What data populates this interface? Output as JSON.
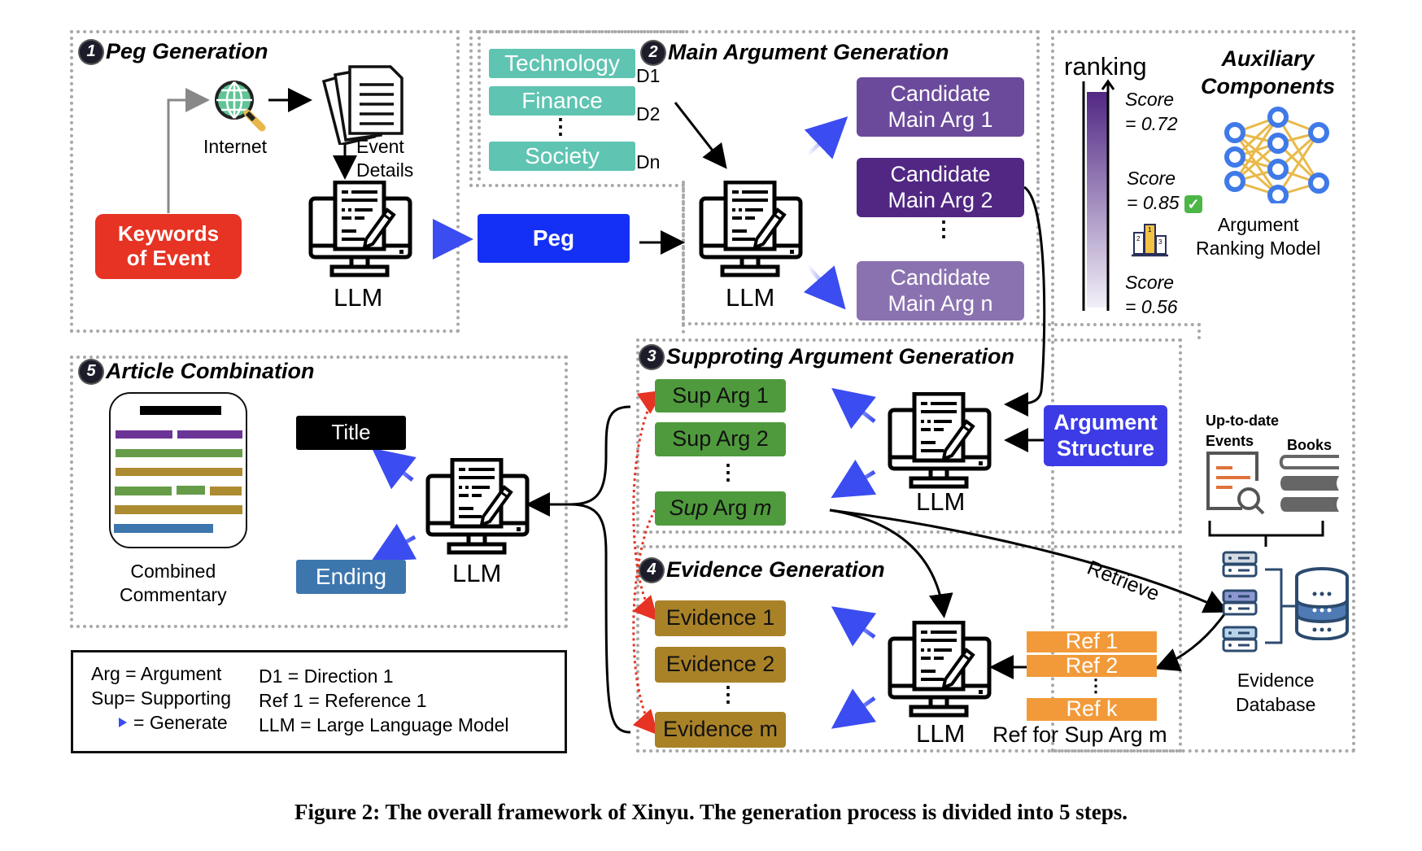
{
  "sections": {
    "s1": {
      "num": "1",
      "title": "Peg Generation"
    },
    "s2": {
      "num": "2",
      "title": "Main Argument Generation"
    },
    "s3": {
      "num": "3",
      "title": "Supproting Argument Generation"
    },
    "s4": {
      "num": "4",
      "title": "Evidence Generation"
    },
    "s5": {
      "num": "5",
      "title": "Article Combination"
    }
  },
  "peg_generation": {
    "keywords": "Keywords of Event",
    "internet_label": "Internet",
    "event_details_label": "Event Details",
    "llm_label": "LLM",
    "peg_label": "Peg"
  },
  "directions": [
    {
      "label": "Technology",
      "tag": "D1"
    },
    {
      "label": "Finance",
      "tag": "D2"
    },
    {
      "label": "Society",
      "tag": "Dn"
    }
  ],
  "main_args": {
    "llm_label": "LLM",
    "candidates": [
      {
        "line1": "Candidate",
        "line2": "Main Arg 1",
        "color": "#6b4a9b"
      },
      {
        "line1": "Candidate",
        "line2": "Main Arg 2",
        "color": "#512783"
      },
      {
        "line1": "Candidate",
        "line2": "Main Arg n",
        "color": "#8a72b0"
      }
    ],
    "ellipsis": "⋮"
  },
  "auxiliary": {
    "title_line1": "Auxiliary",
    "title_line2": "Components",
    "ranking_label": "ranking",
    "scores": [
      {
        "label": "Score",
        "value": "= 0.72"
      },
      {
        "label": "Score",
        "value": "= 0.85",
        "check": "✓"
      },
      {
        "label": "Score",
        "value": "= 0.56"
      }
    ],
    "model_label_line1": "Argument",
    "model_label_line2": "Ranking Model",
    "podium": [
      "2",
      "1",
      "3"
    ]
  },
  "supporting": {
    "llm_label": "LLM",
    "items": [
      "Sup Arg 1",
      "Sup Arg 2"
    ],
    "last_item": {
      "prefix": "Sup",
      "middle": " Arg ",
      "suffix": "m"
    },
    "structure_line1": "Argument",
    "structure_line2": "Structure",
    "ellipsis": "⋮"
  },
  "evidence": {
    "llm_label": "LLM",
    "items": [
      "Evidence 1",
      "Evidence 2",
      "Evidence m"
    ],
    "refs": [
      "Ref 1",
      "Ref 2",
      "Ref k"
    ],
    "refs_caption": "Ref for Sup Arg m",
    "retrieve_label": "Retrieve",
    "ellipsis": "⋮"
  },
  "evidence_db": {
    "events_label_line1": "Up-to-date",
    "events_label_line2": "Events",
    "books_label": "Books",
    "db_label_line1": "Evidence",
    "db_label_line2": "Database"
  },
  "article": {
    "commentary_line1": "Combined",
    "commentary_line2": "Commentary",
    "title_label": "Title",
    "ending_label": "Ending",
    "llm_label": "LLM"
  },
  "legend": {
    "col1": [
      "Arg = Argument",
      "Sup= Supporting",
      "= Generate"
    ],
    "col2": [
      "D1 = Direction 1",
      "Ref 1 = Reference 1",
      "LLM = Large Language Model"
    ]
  },
  "colors": {
    "keywords": "#e63323",
    "peg": "#1530f5",
    "structure": "#3c3be6",
    "teal": "#5fc4b1",
    "green": "#4f9a3d",
    "gold": "#a98228",
    "orange": "#f29a3a",
    "title_box": "#000000",
    "ending_box": "#3d76ad"
  },
  "caption": "Figure 2: The overall framework of Xinyu. The generation process is divided into 5 steps."
}
